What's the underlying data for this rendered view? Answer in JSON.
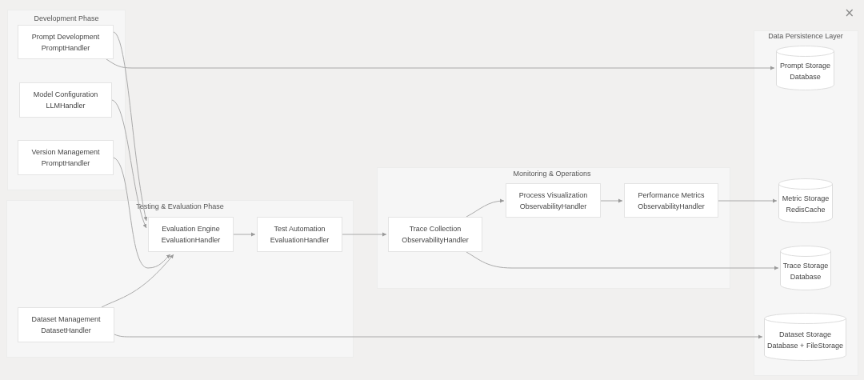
{
  "close_label": "×",
  "groups": [
    {
      "title": "Development Phase",
      "nodes": [
        {
          "title": "Prompt Development",
          "handler": "PromptHandler"
        },
        {
          "title": "Model Configuration",
          "handler": "LLMHandler"
        },
        {
          "title": "Version Management",
          "handler": "PromptHandler"
        }
      ]
    },
    {
      "title": "Testing & Evaluation Phase",
      "nodes": [
        {
          "title": "Evaluation Engine",
          "handler": "EvaluationHandler"
        },
        {
          "title": "Test Automation",
          "handler": "EvaluationHandler"
        },
        {
          "title": "Dataset Management",
          "handler": "DatasetHandler"
        }
      ]
    },
    {
      "title": "Monitoring & Operations",
      "nodes": [
        {
          "title": "Process Visualization",
          "handler": "ObservabilityHandler"
        },
        {
          "title": "Performance Metrics",
          "handler": "ObservabilityHandler"
        },
        {
          "title": "Trace Collection",
          "handler": "ObservabilityHandler"
        }
      ]
    }
  ],
  "storage": {
    "title": "Data Persistence Layer",
    "stores": [
      {
        "title": "Prompt Storage",
        "handler": "Database"
      },
      {
        "title": "Metric Storage",
        "handler": "RedisCache"
      },
      {
        "title": "Trace Storage",
        "handler": "Database"
      },
      {
        "title": "Dataset Storage",
        "handler": "Database + FileStorage"
      }
    ]
  }
}
